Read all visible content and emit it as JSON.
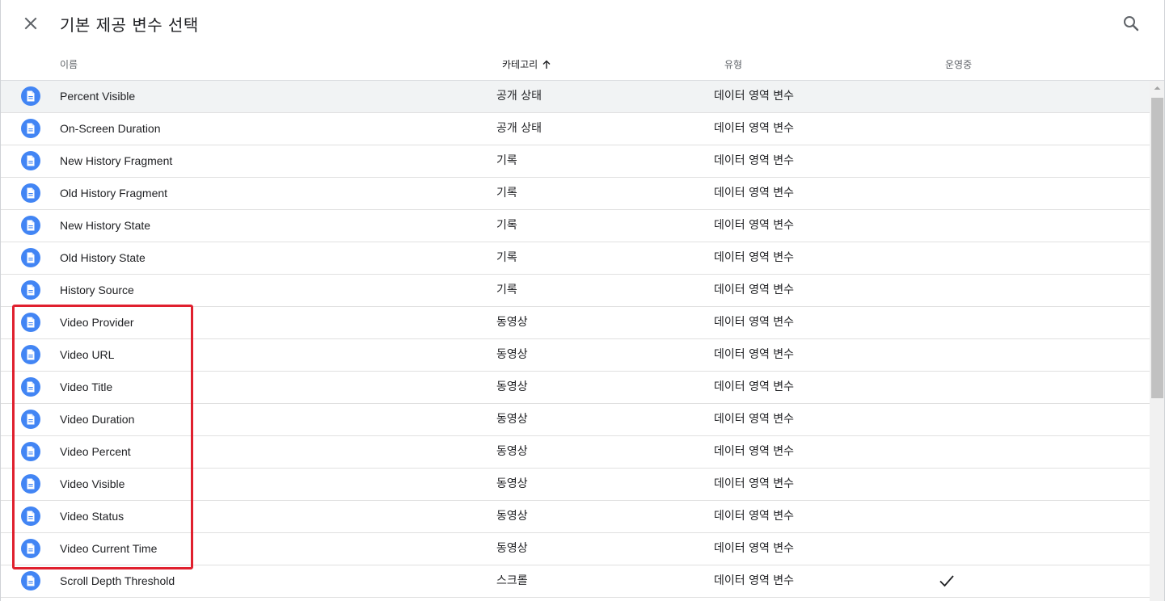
{
  "header": {
    "title": "기본 제공 변수 선택",
    "close_icon": "close-icon",
    "search_icon": "search-icon"
  },
  "columns": {
    "name": "이름",
    "category": "카테고리",
    "type": "유형",
    "active": "운영중"
  },
  "sort": {
    "column": "category",
    "direction": "ascending",
    "icon": "arrow-up-icon"
  },
  "colors": {
    "icon_bg": "#4285f4",
    "highlight": "#e0202e",
    "hover_row": "#f1f3f4"
  },
  "rows": [
    {
      "name": "Percent Visible",
      "category": "공개 상태",
      "type": "데이터 영역 변수",
      "active": false
    },
    {
      "name": "On-Screen Duration",
      "category": "공개 상태",
      "type": "데이터 영역 변수",
      "active": false
    },
    {
      "name": "New History Fragment",
      "category": "기록",
      "type": "데이터 영역 변수",
      "active": false
    },
    {
      "name": "Old History Fragment",
      "category": "기록",
      "type": "데이터 영역 변수",
      "active": false
    },
    {
      "name": "New History State",
      "category": "기록",
      "type": "데이터 영역 변수",
      "active": false
    },
    {
      "name": "Old History State",
      "category": "기록",
      "type": "데이터 영역 변수",
      "active": false
    },
    {
      "name": "History Source",
      "category": "기록",
      "type": "데이터 영역 변수",
      "active": false
    },
    {
      "name": "Video Provider",
      "category": "동영상",
      "type": "데이터 영역 변수",
      "active": false
    },
    {
      "name": "Video URL",
      "category": "동영상",
      "type": "데이터 영역 변수",
      "active": false
    },
    {
      "name": "Video Title",
      "category": "동영상",
      "type": "데이터 영역 변수",
      "active": false
    },
    {
      "name": "Video Duration",
      "category": "동영상",
      "type": "데이터 영역 변수",
      "active": false
    },
    {
      "name": "Video Percent",
      "category": "동영상",
      "type": "데이터 영역 변수",
      "active": false
    },
    {
      "name": "Video Visible",
      "category": "동영상",
      "type": "데이터 영역 변수",
      "active": false
    },
    {
      "name": "Video Status",
      "category": "동영상",
      "type": "데이터 영역 변수",
      "active": false
    },
    {
      "name": "Video Current Time",
      "category": "동영상",
      "type": "데이터 영역 변수",
      "active": false
    },
    {
      "name": "Scroll Depth Threshold",
      "category": "스크롤",
      "type": "데이터 영역 변수",
      "active": true
    }
  ],
  "row_icon": "document-icon",
  "active_icon": "checkmark-icon",
  "highlighted_rows": [
    "Video Provider",
    "Video Current Time"
  ]
}
